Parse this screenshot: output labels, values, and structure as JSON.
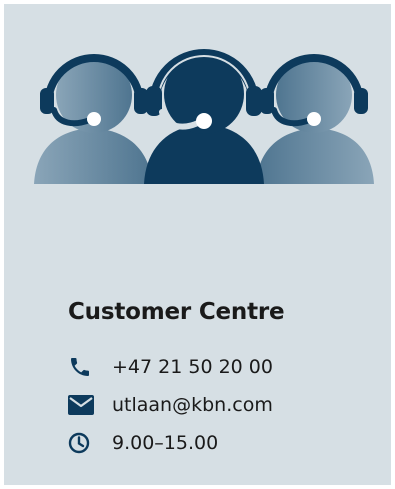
{
  "card": {
    "background": "#d6dfe4",
    "illustration_icon": "support-agents-illustration"
  },
  "heading": "Customer Centre",
  "contacts": [
    {
      "icon": "phone-icon",
      "text": "+47 21 50 20 00"
    },
    {
      "icon": "mail-icon",
      "text": "utlaan@kbn.com"
    },
    {
      "icon": "clock-icon",
      "text": "9.00–15.00"
    }
  ],
  "colors": {
    "dark_blue": "#0d3a5c",
    "mid_blue": "#3f6782",
    "light_blue": "#6a8ca3",
    "text": "#1a1a1a"
  }
}
